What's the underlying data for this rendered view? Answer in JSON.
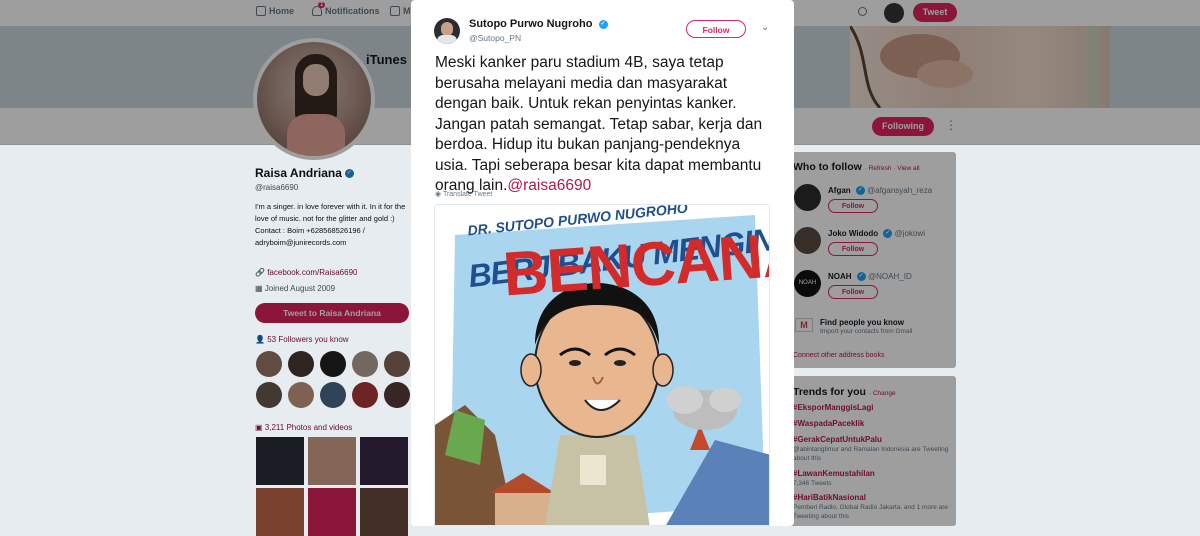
{
  "topnav": {
    "home": "Home",
    "notifications": "Notifications",
    "notifications_badge": "1",
    "messages": "M",
    "tweet_button": "Tweet"
  },
  "profile": {
    "banner_text": "iTunes",
    "name": "Raisa Andriana",
    "handle": "@raisa6690",
    "bio": "I'm a singer. in love forever with it. In it for the love of music. not for the glitter and gold :) Contact : Boim +628568526196 / adryboim@junirecords.com",
    "link": "facebook.com/Raisa6690",
    "joined": "Joined August 2009",
    "tweet_to_button": "Tweet to Raisa Andriana",
    "followers_you_know": "53 Followers you know",
    "photos_videos": "3,211 Photos and videos",
    "following_button": "Following"
  },
  "who_to_follow": {
    "title": "Who to follow",
    "refresh": "Refresh",
    "view_all": "View all",
    "users": [
      {
        "name": "Afgan",
        "handle": "@afgansyah_reza",
        "button": "Follow"
      },
      {
        "name": "Joko Widodo",
        "handle": "@jokowi",
        "button": "Follow"
      },
      {
        "name": "NOAH",
        "handle": "@NOAH_ID",
        "button": "Follow",
        "avatar_text": "NOAH"
      }
    ],
    "find_people": "Find people you know",
    "find_people_sub": "Import your contacts from Gmail",
    "connect_other": "Connect other address books"
  },
  "trends": {
    "title": "Trends for you",
    "change": "Change",
    "items": [
      {
        "tag": "#EksporManggisLagi",
        "meta": ""
      },
      {
        "tag": "#WaspadaPaceklik",
        "meta": ""
      },
      {
        "tag": "#GerakCepatUntukPalu",
        "meta": "@abintangtimur and Ramalan Indonesia are Tweeting about this"
      },
      {
        "tag": "#LawanKemustahilan",
        "meta": "7,346 Tweets"
      },
      {
        "tag": "#HariBatikNasional",
        "meta": "Pemberi Radio, Global Radio Jakarta, and 1 more are Tweeting about this"
      }
    ]
  },
  "tweet": {
    "author_name": "Sutopo Purwo Nugroho",
    "author_handle": "@Sutopo_PN",
    "follow_button": "Follow",
    "text": "Meski kanker paru stadium 4B, saya tetap berusaha melayani media dan masyarakat dengan baik. Untuk rekan penyintas kanker. Jangan patah semangat. Tetap sabar, kerja dan berdoa. Hidup itu bukan panjang-pendeknya usia. Tapi  seberapa besar kita dapat membantu orang lain.",
    "mention": "@raisa6690",
    "translate": "Translate Tweet",
    "image_text": {
      "line1": "DR. SUTOPO PURWO NUGROHO",
      "line2": "BERJIBAKU MENGINFOKAN",
      "line3": "BENCANA"
    }
  },
  "colors": {
    "accent": "#e0245e",
    "link": "#b0184a",
    "verified": "#1da1f2"
  }
}
